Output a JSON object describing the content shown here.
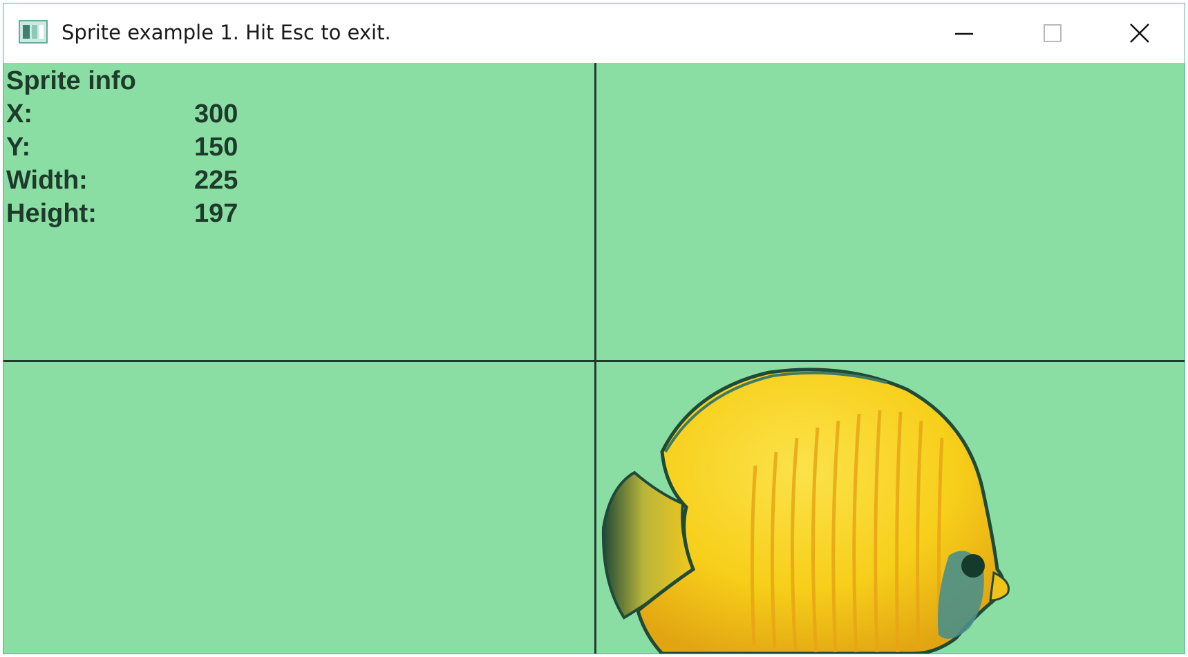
{
  "window": {
    "title": "Sprite example 1.  Hit Esc to exit.",
    "icons": {
      "app": "app-window-icon",
      "minimize": "minimize-icon",
      "maximize": "maximize-icon",
      "close": "close-icon"
    }
  },
  "sprite_info": {
    "heading": "Sprite info",
    "rows": [
      {
        "label": "X:",
        "value": "300"
      },
      {
        "label": "Y:",
        "value": "150"
      },
      {
        "label": "Width:",
        "value": "225"
      },
      {
        "label": "Height:",
        "value": "197"
      }
    ]
  },
  "colors": {
    "background": "#8bdea3",
    "grid_lines": "#1f3b2c",
    "text": "#1d3a2a",
    "fish_body": "#f7cf1a",
    "fish_outline": "#1f4a38"
  },
  "sprite": {
    "name": "yellow-butterflyfish"
  }
}
